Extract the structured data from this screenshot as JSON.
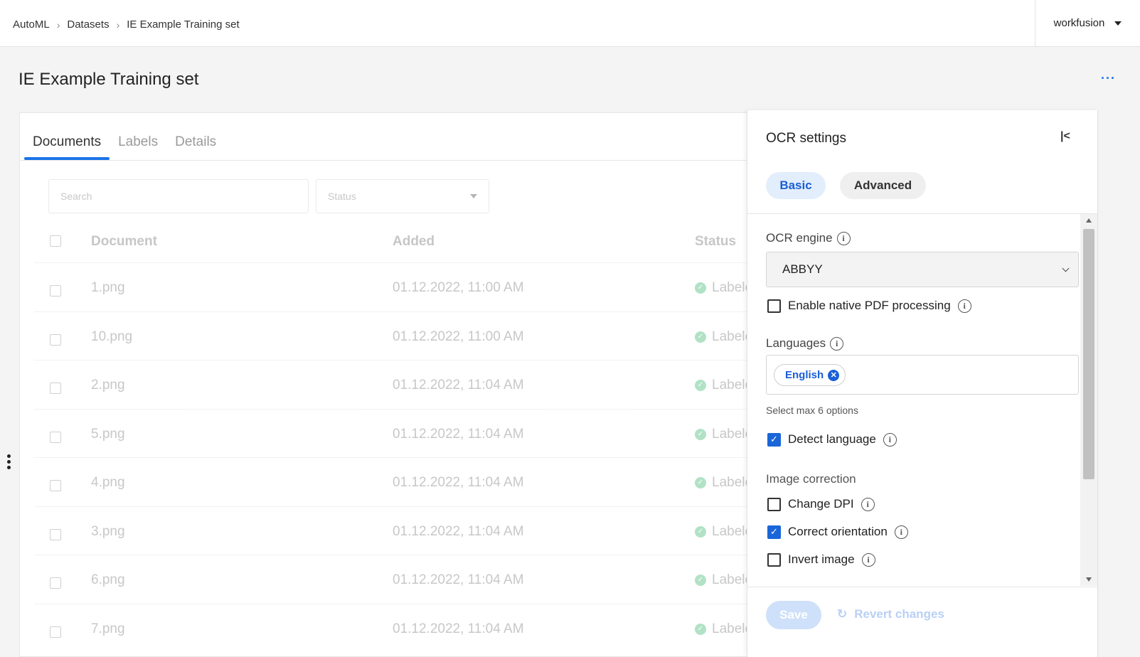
{
  "breadcrumb": {
    "items": [
      "AutoML",
      "Datasets",
      "IE Example Training set"
    ]
  },
  "user": {
    "name": "workfusion"
  },
  "page": {
    "title": "IE Example Training set",
    "more": "···"
  },
  "tabs": [
    "Documents",
    "Labels",
    "Details"
  ],
  "filters": {
    "search_placeholder": "Search",
    "status_placeholder": "Status"
  },
  "table": {
    "columns": [
      "Document",
      "Added",
      "Status"
    ],
    "rows": [
      {
        "document": "1.png",
        "added": "01.12.2022, 11:00 AM",
        "status": "Labeled"
      },
      {
        "document": "10.png",
        "added": "01.12.2022, 11:00 AM",
        "status": "Labeled"
      },
      {
        "document": "2.png",
        "added": "01.12.2022, 11:04 AM",
        "status": "Labeled"
      },
      {
        "document": "5.png",
        "added": "01.12.2022, 11:04 AM",
        "status": "Labeled"
      },
      {
        "document": "4.png",
        "added": "01.12.2022, 11:04 AM",
        "status": "Labeled"
      },
      {
        "document": "3.png",
        "added": "01.12.2022, 11:04 AM",
        "status": "Labeled"
      },
      {
        "document": "6.png",
        "added": "01.12.2022, 11:04 AM",
        "status": "Labeled"
      },
      {
        "document": "7.png",
        "added": "01.12.2022, 11:04 AM",
        "status": "Labeled"
      }
    ]
  },
  "ocr_panel": {
    "title": "OCR settings",
    "modes": [
      "Basic",
      "Advanced"
    ],
    "ocr_engine": {
      "label": "OCR engine",
      "value": "ABBYY"
    },
    "native_pdf": {
      "label": "Enable native PDF processing",
      "checked": false
    },
    "languages": {
      "label": "Languages",
      "selected": [
        "English"
      ],
      "hint": "Select max 6 options"
    },
    "detect_language": {
      "label": "Detect language",
      "checked": true
    },
    "image_correction": {
      "label": "Image correction",
      "options": [
        {
          "label": "Change DPI",
          "checked": false
        },
        {
          "label": "Correct orientation",
          "checked": true
        },
        {
          "label": "Invert image",
          "checked": false
        }
      ]
    },
    "footer": {
      "save": "Save",
      "revert": "Revert changes"
    }
  },
  "colors": {
    "accent": "#1a73e8",
    "success": "#34b26b",
    "checkbox_on": "#1a66d9"
  }
}
